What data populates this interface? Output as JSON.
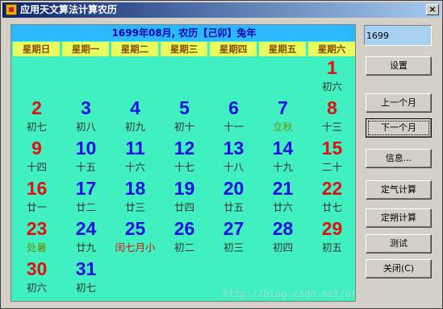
{
  "window": {
    "title": "应用天文算法计算农历",
    "close_label": "×"
  },
  "calendar": {
    "header": "1699年08月, 农历【己卯】兔年",
    "weekdays": [
      "星期日",
      "星期一",
      "星期二",
      "星期三",
      "星期四",
      "星期五",
      "星期六"
    ],
    "days": [
      {
        "d": "1",
        "l": "初六"
      },
      {
        "d": "2",
        "l": "初七"
      },
      {
        "d": "3",
        "l": "初八"
      },
      {
        "d": "4",
        "l": "初九"
      },
      {
        "d": "5",
        "l": "初十"
      },
      {
        "d": "6",
        "l": "十一"
      },
      {
        "d": "7",
        "l": "立秋"
      },
      {
        "d": "8",
        "l": "十三"
      },
      {
        "d": "9",
        "l": "十四"
      },
      {
        "d": "10",
        "l": "十五"
      },
      {
        "d": "11",
        "l": "十六"
      },
      {
        "d": "12",
        "l": "十七"
      },
      {
        "d": "13",
        "l": "十八"
      },
      {
        "d": "14",
        "l": "十九"
      },
      {
        "d": "15",
        "l": "二十"
      },
      {
        "d": "16",
        "l": "廿一"
      },
      {
        "d": "17",
        "l": "廿二"
      },
      {
        "d": "18",
        "l": "廿三"
      },
      {
        "d": "19",
        "l": "廿四"
      },
      {
        "d": "20",
        "l": "廿五"
      },
      {
        "d": "21",
        "l": "廿六"
      },
      {
        "d": "22",
        "l": "廿七"
      },
      {
        "d": "23",
        "l": "处暑"
      },
      {
        "d": "24",
        "l": "廿九"
      },
      {
        "d": "25",
        "l": "闰七月小"
      },
      {
        "d": "26",
        "l": "初二"
      },
      {
        "d": "27",
        "l": "初三"
      },
      {
        "d": "28",
        "l": "初四"
      },
      {
        "d": "29",
        "l": "初五"
      },
      {
        "d": "30",
        "l": "初六"
      },
      {
        "d": "31",
        "l": "初七"
      }
    ],
    "watermark": "http://blog.csdn.net/orbit/"
  },
  "controls": {
    "year_value": "1699",
    "settings": "设置",
    "prev_month": "上一个月",
    "next_month": "下一个月",
    "info": "信息...",
    "solar_terms": "定气计算",
    "new_moons": "定朔计算",
    "test": "测试",
    "close": "关闭(C)"
  }
}
